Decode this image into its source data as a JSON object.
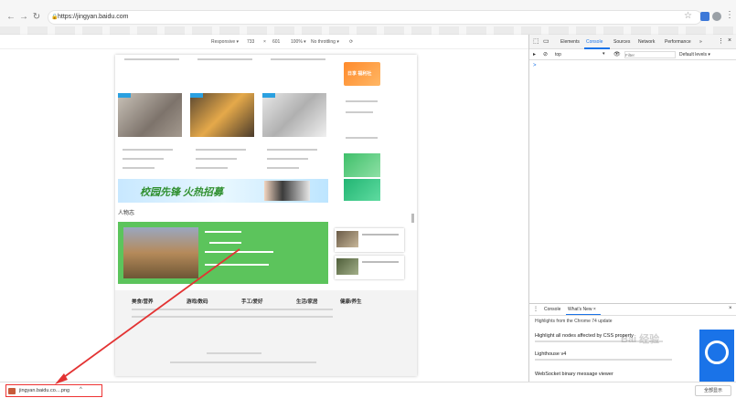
{
  "browser": {
    "url": "https://jingyan.baidu.com"
  },
  "device_toolbar": {
    "device": "Responsive ▾",
    "width": "733",
    "times": "×",
    "height": "601",
    "zoom": "100% ▾",
    "throttle": "No throttling ▾"
  },
  "devtools": {
    "tabs": [
      "Elements",
      "Console",
      "Sources",
      "Network",
      "Performance",
      "»"
    ],
    "context": "top",
    "filter_placeholder": "Filter",
    "levels": "Default levels ▾",
    "prompt": ">",
    "drawer_tabs": [
      "Console",
      "What's New ×"
    ],
    "drawer_heading": "Highlights from the Chrome 74 update",
    "drawer_lines": [
      "Highlight all nodes affected by CSS property",
      "Lighthouse v4",
      "WebSocket binary message viewer"
    ]
  },
  "page": {
    "section_title": "人物志",
    "banner_text": "校园先锋 火热招募",
    "right_ad": "日享 福利社",
    "categories": [
      "美食/营养",
      "游戏/数码",
      "手工/爱好",
      "生活/家居",
      "健康/养生"
    ]
  },
  "download": {
    "filename": "jingyan.baidu.co....png",
    "chevron": "^",
    "show_all": "全部显示"
  },
  "watermark": "Bai 经验",
  "colors": {
    "accent_green": "#5cc45c",
    "highlight_red": "#e33333"
  }
}
